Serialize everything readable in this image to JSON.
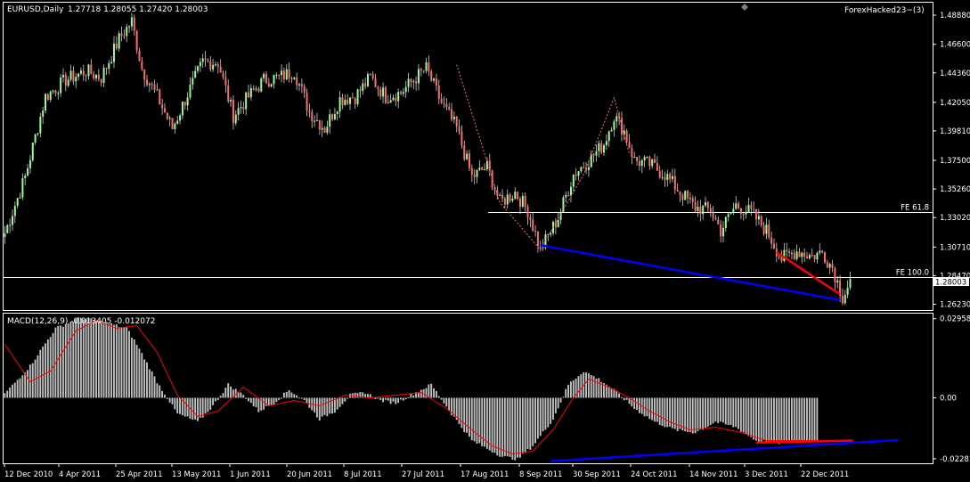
{
  "header": {
    "symbol": "EURUSD,Daily",
    "ohlc": "1.27718 1.28055 1.27420 1.28003",
    "indicator_name": "ForexHacked23~(3)"
  },
  "macd": {
    "label": "MACD(12,26,9) -0.013405 -0.012072"
  },
  "price_axis": {
    "ticks": [
      "1.48880",
      "1.46600",
      "1.44360",
      "1.42050",
      "1.39810",
      "1.37500",
      "1.35260",
      "1.33020",
      "1.30710",
      "1.28470",
      "1.26230"
    ],
    "current": "1.28003"
  },
  "macd_axis": {
    "ticks": [
      "0.029589",
      "0.00",
      "-0.022810"
    ]
  },
  "date_axis": {
    "ticks": [
      "12 Dec 2010",
      "4 Apr 2011",
      "25 Apr 2011",
      "13 May 2011",
      "1 Jun 2011",
      "20 Jun 2011",
      "8 Jul 2011",
      "27 Jul 2011",
      "17 Aug 2011",
      "8 Sep 2011",
      "30 Sep 2011",
      "24 Oct 2011",
      "14 Nov 2011",
      "3 Dec 2011",
      "22 Dec 2011"
    ]
  },
  "levels": [
    {
      "label": "FE 61.8",
      "price": 1.3344
    },
    {
      "label": "FE 100.0",
      "price": 1.2836
    }
  ],
  "colors": {
    "bull": "#98fb98",
    "bear": "#ff6a6a",
    "wick": "#d0d0d0",
    "signal": "#ff0000",
    "trend_blue": "#0000ff",
    "trend_red": "#ff0000",
    "hist": "#c0c0c0",
    "grid_line": "#ffffff"
  },
  "chart_data": {
    "type": "candlestick",
    "price_range": [
      1.2577,
      1.4993
    ],
    "macd_range": [
      -0.0245,
      0.0315
    ],
    "anchors": [
      [
        0,
        1.318
      ],
      [
        8,
        1.362
      ],
      [
        16,
        1.425
      ],
      [
        24,
        1.438
      ],
      [
        32,
        1.445
      ],
      [
        38,
        1.44
      ],
      [
        45,
        1.47
      ],
      [
        50,
        1.484
      ],
      [
        54,
        1.447
      ],
      [
        60,
        1.425
      ],
      [
        66,
        1.4
      ],
      [
        72,
        1.427
      ],
      [
        78,
        1.452
      ],
      [
        84,
        1.452
      ],
      [
        90,
        1.41
      ],
      [
        96,
        1.425
      ],
      [
        102,
        1.438
      ],
      [
        108,
        1.44
      ],
      [
        114,
        1.445
      ],
      [
        120,
        1.413
      ],
      [
        126,
        1.4
      ],
      [
        132,
        1.423
      ],
      [
        138,
        1.425
      ],
      [
        144,
        1.44
      ],
      [
        150,
        1.425
      ],
      [
        156,
        1.428
      ],
      [
        162,
        1.44
      ],
      [
        166,
        1.447
      ],
      [
        172,
        1.42
      ],
      [
        178,
        1.4
      ],
      [
        184,
        1.362
      ],
      [
        190,
        1.37
      ],
      [
        195,
        1.342
      ],
      [
        201,
        1.35
      ],
      [
        206,
        1.336
      ],
      [
        211,
        1.305
      ],
      [
        218,
        1.33
      ],
      [
        224,
        1.364
      ],
      [
        230,
        1.375
      ],
      [
        236,
        1.388
      ],
      [
        240,
        1.41
      ],
      [
        244,
        1.398
      ],
      [
        248,
        1.375
      ],
      [
        254,
        1.372
      ],
      [
        260,
        1.364
      ],
      [
        266,
        1.35
      ],
      [
        272,
        1.338
      ],
      [
        278,
        1.336
      ],
      [
        282,
        1.32
      ],
      [
        288,
        1.34
      ],
      [
        294,
        1.334
      ],
      [
        300,
        1.32
      ],
      [
        306,
        1.298
      ],
      [
        312,
        1.304
      ],
      [
        318,
        1.3
      ],
      [
        322,
        1.303
      ],
      [
        326,
        1.291
      ],
      [
        330,
        1.268
      ],
      [
        333,
        1.28
      ]
    ],
    "macd_hist": [
      [
        0,
        0.0015
      ],
      [
        10,
        0.012
      ],
      [
        20,
        0.026
      ],
      [
        30,
        0.03
      ],
      [
        40,
        0.028
      ],
      [
        48,
        0.026
      ],
      [
        52,
        0.02
      ],
      [
        60,
        0.006
      ],
      [
        68,
        -0.006
      ],
      [
        76,
        -0.009
      ],
      [
        82,
        -0.003
      ],
      [
        88,
        0.005
      ],
      [
        94,
        0.001
      ],
      [
        100,
        -0.005
      ],
      [
        106,
        -0.002
      ],
      [
        112,
        0.003
      ],
      [
        118,
        -0.001
      ],
      [
        124,
        -0.008
      ],
      [
        130,
        -0.005
      ],
      [
        136,
        0.001
      ],
      [
        142,
        0.002
      ],
      [
        148,
        -0.001
      ],
      [
        154,
        -0.002
      ],
      [
        160,
        0.001
      ],
      [
        168,
        0.005
      ],
      [
        176,
        -0.006
      ],
      [
        184,
        -0.016
      ],
      [
        190,
        -0.019
      ],
      [
        196,
        -0.022
      ],
      [
        202,
        -0.023
      ],
      [
        208,
        -0.018
      ],
      [
        216,
        -0.008
      ],
      [
        222,
        0.005
      ],
      [
        228,
        0.01
      ],
      [
        234,
        0.007
      ],
      [
        240,
        0.003
      ],
      [
        248,
        -0.004
      ],
      [
        256,
        -0.009
      ],
      [
        264,
        -0.012
      ],
      [
        272,
        -0.013
      ],
      [
        280,
        -0.009
      ],
      [
        288,
        -0.011
      ],
      [
        296,
        -0.016
      ],
      [
        304,
        -0.017
      ],
      [
        312,
        -0.016
      ],
      [
        320,
        -0.016
      ]
    ],
    "signal_line": [
      [
        0,
        0.02
      ],
      [
        10,
        0.006
      ],
      [
        18,
        0.01
      ],
      [
        28,
        0.025
      ],
      [
        36,
        0.029
      ],
      [
        44,
        0.026
      ],
      [
        52,
        0.027
      ],
      [
        60,
        0.017
      ],
      [
        68,
        0.001
      ],
      [
        76,
        -0.007
      ],
      [
        84,
        -0.005
      ],
      [
        94,
        0.004
      ],
      [
        104,
        -0.003
      ],
      [
        114,
        -0.001
      ],
      [
        124,
        -0.003
      ],
      [
        134,
        0.001
      ],
      [
        144,
        0.0
      ],
      [
        154,
        0.001
      ],
      [
        164,
        0.002
      ],
      [
        174,
        -0.004
      ],
      [
        184,
        -0.012
      ],
      [
        192,
        -0.018
      ],
      [
        200,
        -0.021
      ],
      [
        208,
        -0.02
      ],
      [
        216,
        -0.012
      ],
      [
        224,
        0.0
      ],
      [
        230,
        0.007
      ],
      [
        238,
        0.004
      ],
      [
        246,
        0.0
      ],
      [
        254,
        -0.005
      ],
      [
        262,
        -0.009
      ],
      [
        270,
        -0.012
      ],
      [
        280,
        -0.011
      ],
      [
        290,
        -0.013
      ],
      [
        300,
        -0.016
      ],
      [
        310,
        -0.016
      ],
      [
        320,
        -0.016
      ]
    ],
    "zigzag": [
      [
        178,
        1.45
      ],
      [
        195,
        1.342
      ],
      [
        211,
        1.305
      ],
      [
        228,
        1.364
      ],
      [
        240,
        1.424
      ],
      [
        246,
        1.38
      ]
    ],
    "trendlines": [
      {
        "color_key": "trend_blue",
        "pane": "price",
        "from": [
          211,
          1.3085
        ],
        "to": [
          329,
          1.2655
        ]
      },
      {
        "color_key": "trend_red",
        "pane": "price",
        "from": [
          304,
          1.303
        ],
        "to": [
          329,
          1.27
        ]
      },
      {
        "color_key": "trend_blue",
        "pane": "macd",
        "from": [
          215,
          -0.0237
        ],
        "to": [
          352,
          -0.0158
        ]
      },
      {
        "color_key": "trend_red",
        "pane": "macd",
        "from": [
          296,
          -0.0168
        ],
        "to": [
          334,
          -0.016
        ]
      }
    ]
  }
}
